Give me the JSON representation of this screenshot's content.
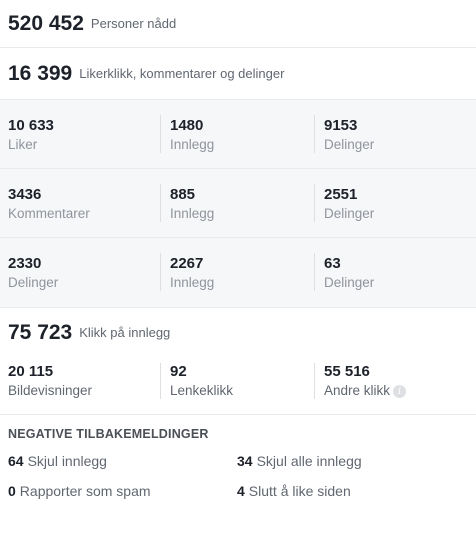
{
  "reach": {
    "value": "520 452",
    "label": "Personer nådd"
  },
  "engagement": {
    "value": "16 399",
    "label": "Likerklikk, kommentarer og delinger"
  },
  "breakdown": [
    [
      {
        "value": "10 633",
        "label": "Liker"
      },
      {
        "value": "1480",
        "label": "Innlegg"
      },
      {
        "value": "9153",
        "label": "Delinger"
      }
    ],
    [
      {
        "value": "3436",
        "label": "Kommentarer"
      },
      {
        "value": "885",
        "label": "Innlegg"
      },
      {
        "value": "2551",
        "label": "Delinger"
      }
    ],
    [
      {
        "value": "2330",
        "label": "Delinger"
      },
      {
        "value": "2267",
        "label": "Innlegg"
      },
      {
        "value": "63",
        "label": "Delinger"
      }
    ]
  ],
  "clicks": {
    "value": "75 723",
    "label": "Klikk på innlegg",
    "items": [
      {
        "value": "20 115",
        "label": "Bildevisninger"
      },
      {
        "value": "92",
        "label": "Lenkeklikk"
      },
      {
        "value": "55 516",
        "label": "Andre klikk",
        "icon": "info-icon"
      }
    ]
  },
  "negative": {
    "title": "NEGATIVE TILBAKEMELDINGER",
    "items": [
      {
        "value": "64",
        "label": "Skjul innlegg"
      },
      {
        "value": "34",
        "label": "Skjul alle innlegg"
      },
      {
        "value": "0",
        "label": "Rapporter som spam"
      },
      {
        "value": "4",
        "label": "Slutt å like siden"
      }
    ]
  }
}
